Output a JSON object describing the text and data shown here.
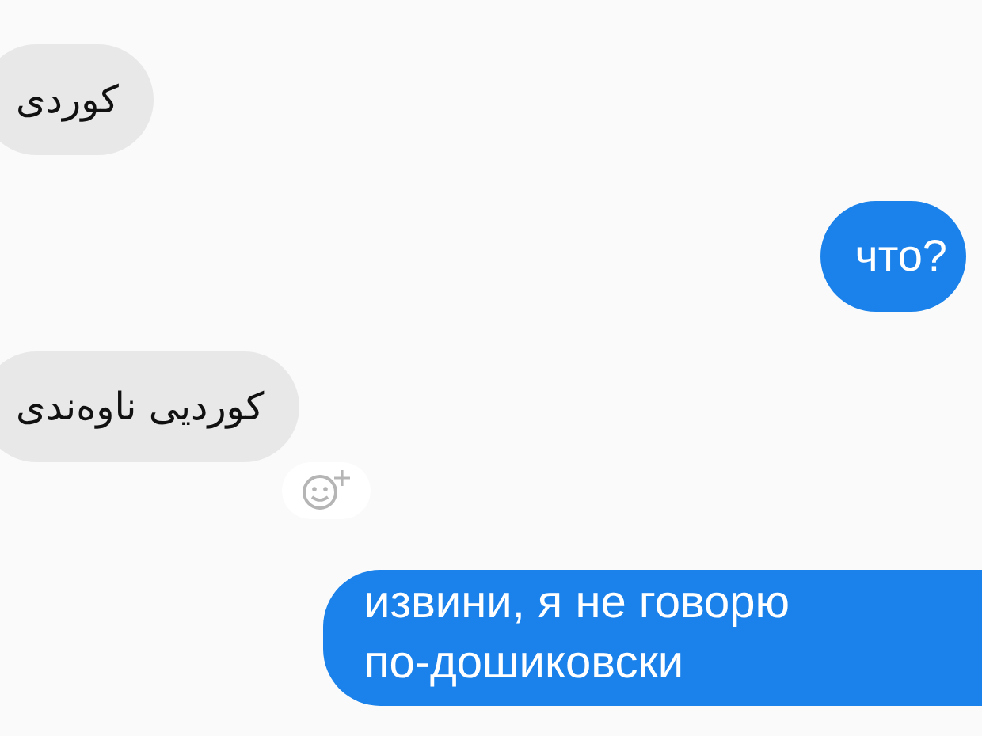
{
  "messages": [
    {
      "kind": "received",
      "text": "کوردی",
      "reaction_button": false
    },
    {
      "kind": "sent",
      "text": "что?",
      "reaction_button": false
    },
    {
      "kind": "received",
      "text": "کوردیی ناوەندی",
      "reaction_button": true
    },
    {
      "kind": "sent",
      "text": "извини, я не говорю по-дошиковски",
      "reaction_button": false
    }
  ]
}
